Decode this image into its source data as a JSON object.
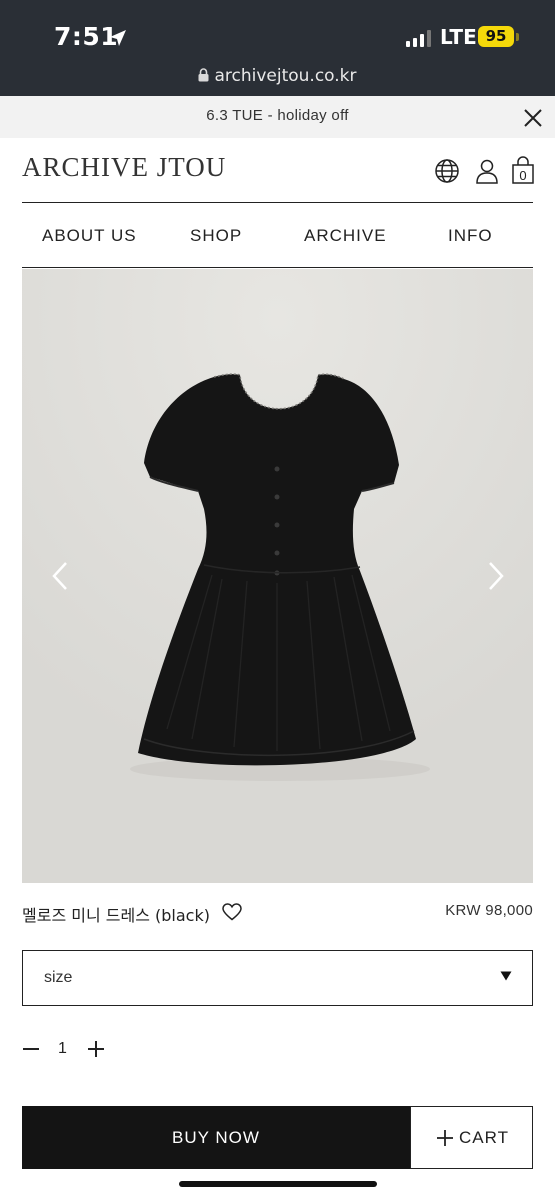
{
  "status_bar": {
    "time": "7:51",
    "network": "LTE",
    "battery": "95"
  },
  "browser": {
    "url": "archivejtou.co.kr"
  },
  "notice": {
    "text": "6.3 TUE - holiday off"
  },
  "header": {
    "logo": "ARCHIVE JTOU",
    "cart_count": "0"
  },
  "nav": {
    "items": [
      "ABOUT US",
      "SHOP",
      "ARCHIVE",
      "INFO"
    ]
  },
  "product": {
    "name": "멜로즈 미니 드레스 (black)",
    "price": "KRW 98,000",
    "size_placeholder": "size",
    "quantity": "1"
  },
  "actions": {
    "buy_now": "BUY NOW",
    "cart": "CART"
  },
  "colors": {
    "chrome": "#2a2f36",
    "battery": "#f5d90a",
    "photo_bg": "#dddcd8",
    "dress": "#151515",
    "buy_button": "#141414"
  }
}
